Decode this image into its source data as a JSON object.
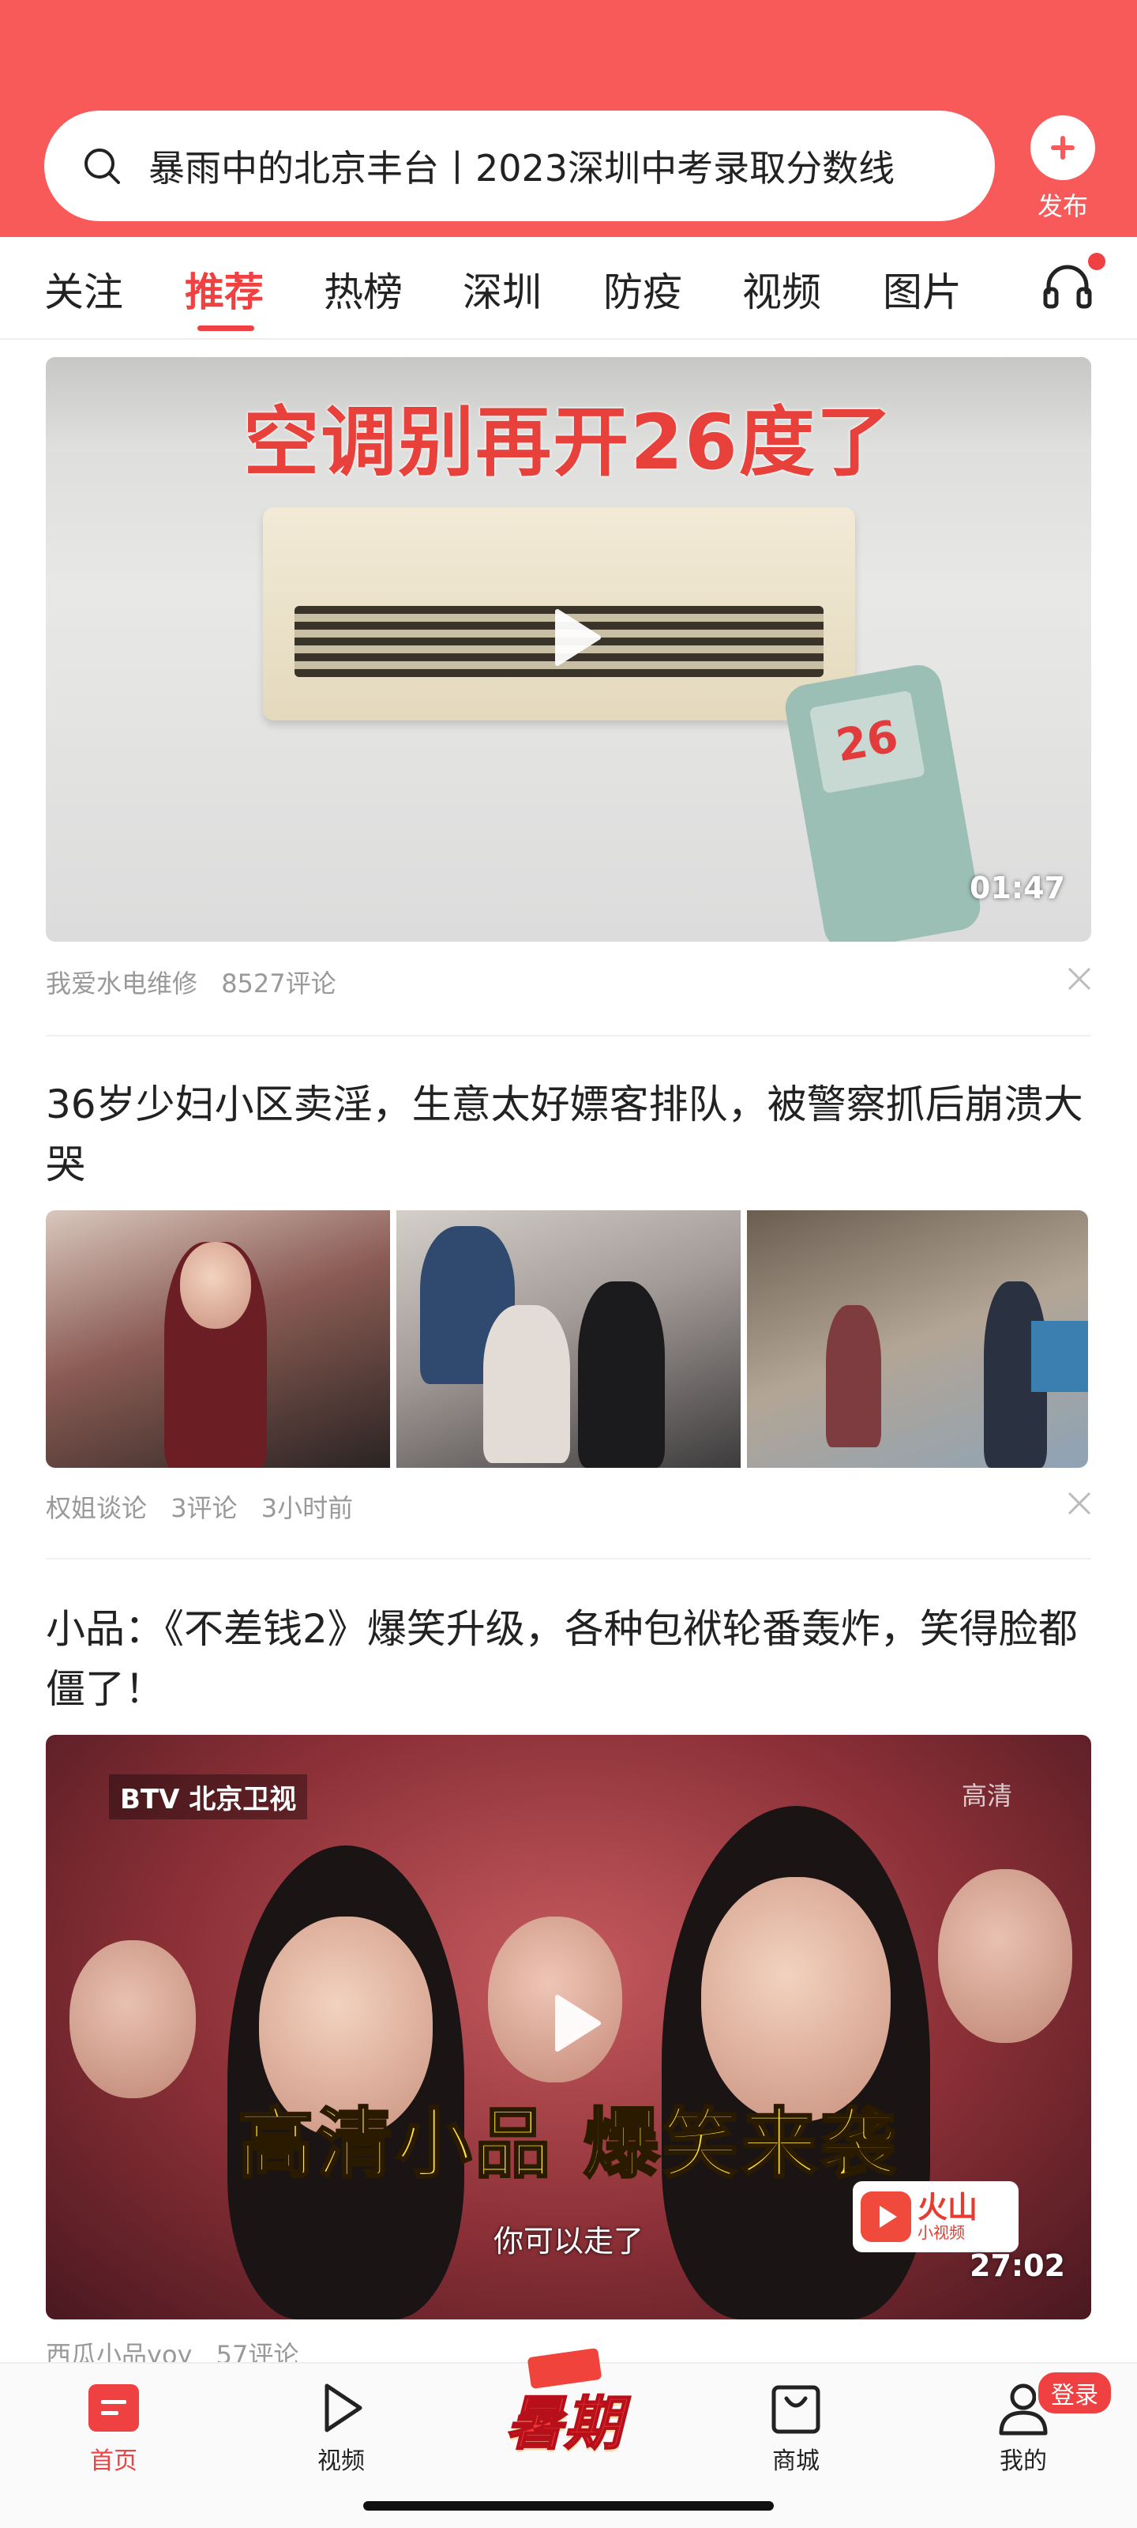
{
  "header": {
    "search_hint": "暴雨中的北京丰台丨2023深圳中考录取分数线",
    "publish_label": "发布"
  },
  "tabs": [
    {
      "label": "关注"
    },
    {
      "label": "推荐",
      "active": true
    },
    {
      "label": "热榜"
    },
    {
      "label": "深圳"
    },
    {
      "label": "防疫"
    },
    {
      "label": "视频"
    },
    {
      "label": "图片"
    }
  ],
  "feed": {
    "video1": {
      "overlay_text": "空调别再开26度了",
      "remote_display": "26",
      "duration": "01:47",
      "source": "我爱水电维修",
      "comments": "8527评论"
    },
    "article2": {
      "title": "36岁少妇小区卖淫，生意太好嫖客排队，被警察抓后崩溃大哭",
      "source": "权姐谈论",
      "comments": "3评论",
      "time": "3小时前"
    },
    "video3": {
      "title": "小品：《不差钱2》爆笑升级，各种包袱轮番轰炸，笑得脸都僵了！",
      "channel_logo": "BTV 北京卫视",
      "hd_mark": "高清",
      "caption": "高清小品 爆笑来袭",
      "subtitle": "你可以走了",
      "app_logo_main": "火山",
      "app_logo_sub": "小视频",
      "duration": "27:02",
      "source": "西瓜小品yoy",
      "comments": "57评论"
    }
  },
  "bottom_nav": {
    "home": "首页",
    "video": "视频",
    "promo": "暑期",
    "mall": "商城",
    "mine": "我的",
    "login_badge": "登录"
  },
  "colors": {
    "brand_red": "#f85959",
    "active_tab": "#f04142"
  }
}
